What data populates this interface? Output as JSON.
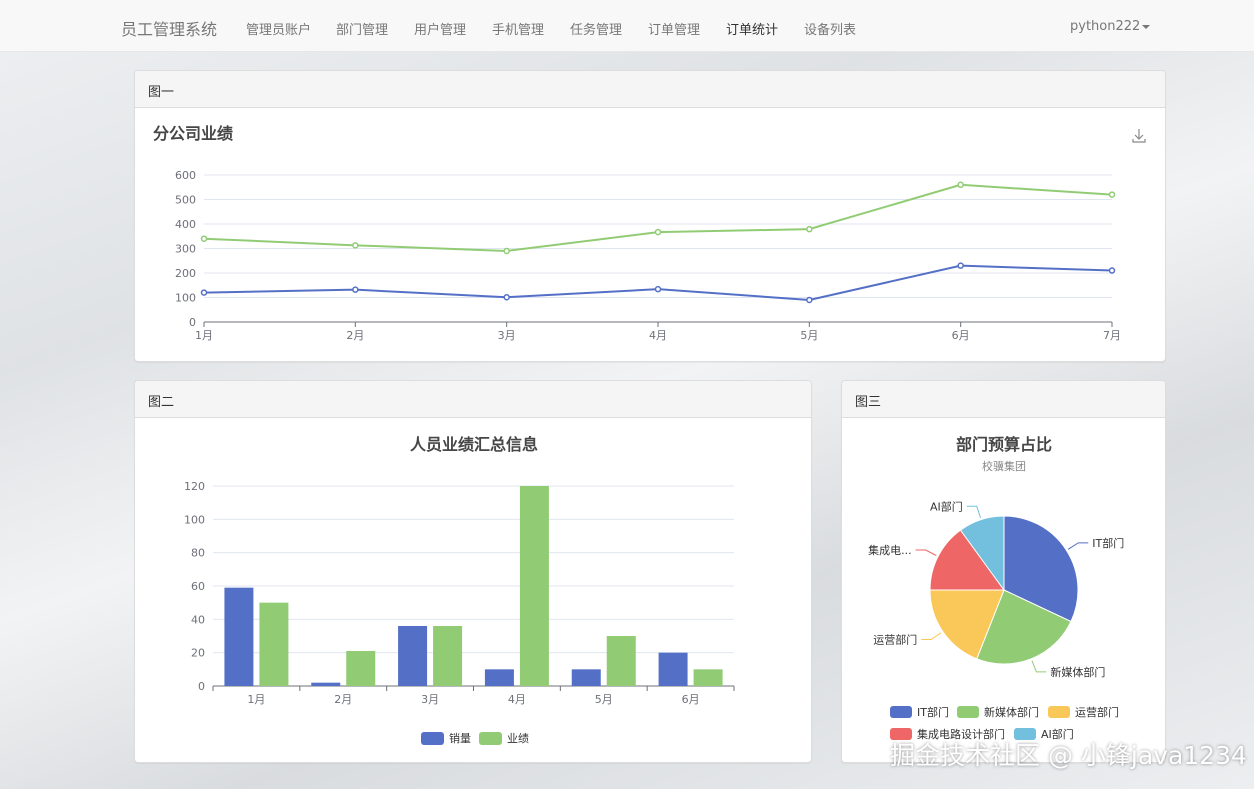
{
  "nav": {
    "brand": "员工管理系统",
    "items": [
      {
        "label": "管理员账户"
      },
      {
        "label": "部门管理"
      },
      {
        "label": "用户管理"
      },
      {
        "label": "手机管理"
      },
      {
        "label": "任务管理"
      },
      {
        "label": "订单管理"
      },
      {
        "label": "订单统计",
        "active": true
      },
      {
        "label": "设备列表"
      }
    ],
    "user": "python222"
  },
  "panels": {
    "line": {
      "heading": "图一"
    },
    "bar": {
      "heading": "图二"
    },
    "pie": {
      "heading": "图三"
    }
  },
  "chart_data": [
    {
      "type": "line",
      "title": "分公司业绩",
      "categories": [
        "1月",
        "2月",
        "3月",
        "4月",
        "5月",
        "6月",
        "7月"
      ],
      "ylim": [
        0,
        600
      ],
      "yticks": [
        "0",
        "100",
        "200",
        "300",
        "400",
        "500",
        "600"
      ],
      "grid": true,
      "series": [
        {
          "values": [
            340,
            313,
            290,
            367,
            379,
            560,
            520
          ],
          "color": "#91cc75"
        },
        {
          "values": [
            120,
            132,
            101,
            134,
            90,
            230,
            210
          ],
          "color": "#5470c6"
        }
      ]
    },
    {
      "type": "bar",
      "title": "人员业绩汇总信息",
      "categories": [
        "1月",
        "2月",
        "3月",
        "4月",
        "5月",
        "6月"
      ],
      "ylim": [
        0,
        120
      ],
      "yticks": [
        "0",
        "20",
        "40",
        "60",
        "80",
        "100",
        "120"
      ],
      "grid": true,
      "legend_position": "bottom",
      "series": [
        {
          "name": "销量",
          "values": [
            59,
            2,
            36,
            10,
            10,
            20
          ],
          "color": "#5470c6"
        },
        {
          "name": "业绩",
          "values": [
            50,
            21,
            36,
            120,
            30,
            10
          ],
          "color": "#91cc75"
        }
      ]
    },
    {
      "type": "pie",
      "title": "部门预算占比",
      "subtitle": "校骥集团",
      "legend_position": "bottom",
      "slices": [
        {
          "name": "IT部门",
          "label": "IT部门",
          "value": 32,
          "color": "#5470c6"
        },
        {
          "name": "新媒体部门",
          "label": "新媒体部门",
          "value": 24,
          "color": "#91cc75"
        },
        {
          "name": "运营部门",
          "label": "运营部门",
          "value": 19,
          "color": "#fac858"
        },
        {
          "name": "集成电路设计部门",
          "label": "集成电...",
          "value": 15,
          "color": "#ee6666"
        },
        {
          "name": "AI部门",
          "label": "AI部门",
          "value": 10,
          "color": "#73c0de"
        }
      ]
    }
  ],
  "watermark": "掘金技术社区 @ 小锋java1234"
}
